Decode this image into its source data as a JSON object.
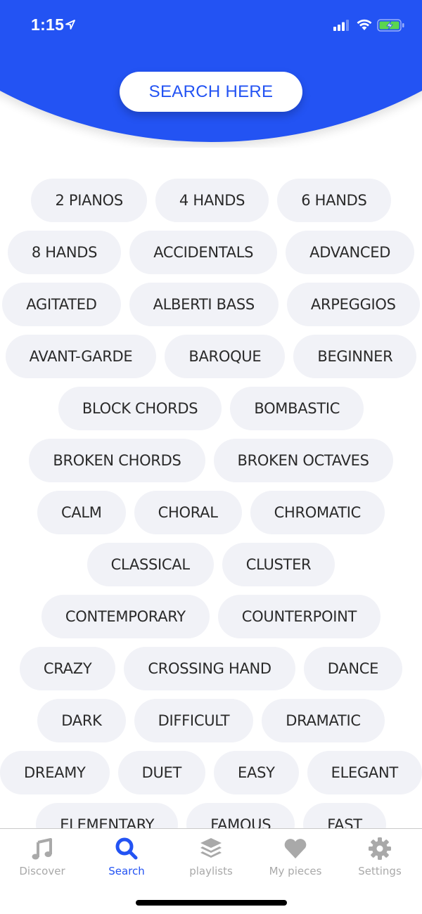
{
  "status_bar": {
    "time": "1:15",
    "icons": [
      "location-arrow-icon",
      "cellular-signal-icon",
      "wifi-icon",
      "battery-charging-icon"
    ]
  },
  "header": {
    "search_button_label": "SEARCH HERE",
    "accent_color": "#2353f3"
  },
  "tags": {
    "rows": [
      [
        "2 PIANOS",
        "4 HANDS",
        "6 HANDS"
      ],
      [
        "8 HANDS",
        "ACCIDENTALS",
        "ADVANCED"
      ],
      [
        "AGITATED",
        "ALBERTI BASS",
        "ARPEGGIOS"
      ],
      [
        "AVANT-GARDE",
        "BAROQUE",
        "BEGINNER"
      ],
      [
        "BLOCK CHORDS",
        "BOMBASTIC"
      ],
      [
        "BROKEN CHORDS",
        "BROKEN OCTAVES"
      ],
      [
        "CALM",
        "CHORAL",
        "CHROMATIC"
      ],
      [
        "CLASSICAL",
        "CLUSTER"
      ],
      [
        "CONTEMPORARY",
        "COUNTERPOINT"
      ],
      [
        "CRAZY",
        "CROSSING HAND",
        "DANCE"
      ],
      [
        "DARK",
        "DIFFICULT",
        "DRAMATIC"
      ],
      [
        "DREAMY",
        "DUET",
        "EASY",
        "ELEGANT"
      ],
      [
        "ELEMENTARY",
        "FAMOUS",
        "FAST"
      ]
    ]
  },
  "tab_bar": {
    "active": "Search",
    "items": [
      {
        "label": "Discover",
        "icon": "music-note-icon"
      },
      {
        "label": "Search",
        "icon": "search-icon"
      },
      {
        "label": "playlists",
        "icon": "layers-icon"
      },
      {
        "label": "My pieces",
        "icon": "heart-icon"
      },
      {
        "label": "Settings",
        "icon": "gear-icon"
      }
    ]
  }
}
